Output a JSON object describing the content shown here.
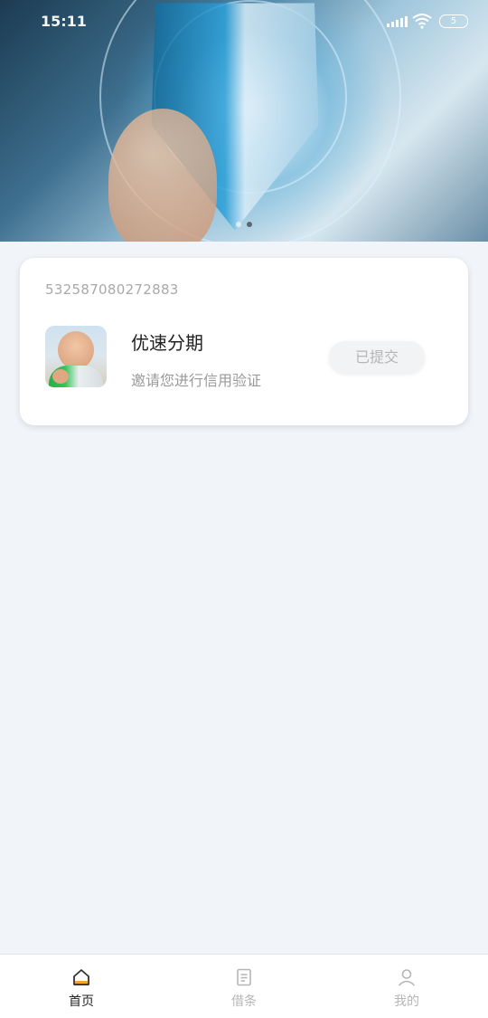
{
  "status_bar": {
    "time": "15:11",
    "battery": "5"
  },
  "banner": {
    "dots_total": 2,
    "active_dot": 2
  },
  "card": {
    "id": "532587080272883",
    "app_name": "优速分期",
    "description": "邀请您进行信用验证",
    "button_label": "已提交"
  },
  "bottom_nav": {
    "items": [
      {
        "label": "首页",
        "icon": "home-icon",
        "active": true
      },
      {
        "label": "借条",
        "icon": "document-icon",
        "active": false
      },
      {
        "label": "我的",
        "icon": "user-icon",
        "active": false
      }
    ]
  },
  "colors": {
    "background": "#f1f5fa",
    "active_icon_accent": "#f5a623",
    "inactive_text": "#b5b5b5"
  }
}
